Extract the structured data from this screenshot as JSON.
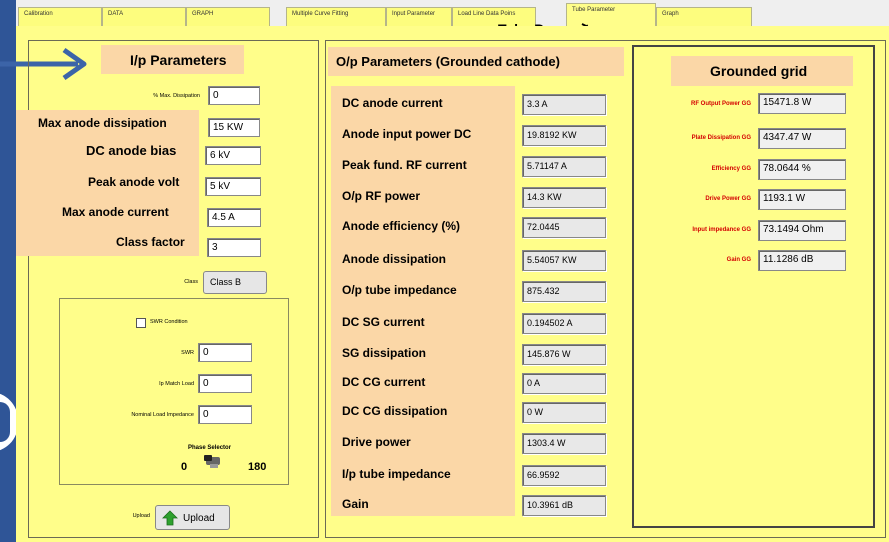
{
  "tabs": [
    "Calibration",
    "DATA",
    "GRAPH",
    "Multiple Curve Fitting",
    "Input Parameter",
    "Load Line Data Poins",
    "Tube Parameter",
    "Graph"
  ],
  "active_tab": "Tube Parameter",
  "annotation_label": "Tube Parameters",
  "input_panel": {
    "title": "I/p Parameters",
    "rows": [
      {
        "label": "% Max. Dissipation",
        "value": "0"
      },
      {
        "label": "Max anode dissipation",
        "value": "15 KW"
      },
      {
        "label": "DC anode bias",
        "value": "6 kV"
      },
      {
        "label": "Peak anode volt",
        "value": "5 kV"
      },
      {
        "label": "Max anode current",
        "value": "4.5 A"
      },
      {
        "label": "Class factor",
        "value": "3"
      },
      {
        "label": "Class",
        "value": "Class B"
      }
    ],
    "swr_checkbox_label": "SWR Condition",
    "swr_rows": [
      {
        "label": "SWR",
        "value": "0"
      },
      {
        "label": "Ip Match Load",
        "value": "0"
      },
      {
        "label": "Nominal Load Impedance",
        "value": "0"
      }
    ],
    "phase_selector": {
      "label": "Phase Selector",
      "min": "0",
      "max": "180"
    },
    "upload_label": "Upload",
    "upload_button": "Upload"
  },
  "output_panel": {
    "title": "O/p Parameters (Grounded cathode)",
    "rows": [
      {
        "label": "DC anode current",
        "value": "3.3 A"
      },
      {
        "label": "Anode input power DC",
        "value": "19.8192 KW"
      },
      {
        "label": "Peak fund. RF current",
        "value": "5.71147 A"
      },
      {
        "label": "O/p RF power",
        "value": "14.3 KW"
      },
      {
        "label": "Anode efficiency (%)",
        "value": "72.0445"
      },
      {
        "label": "Anode dissipation",
        "value": "5.54057 KW"
      },
      {
        "label": "O/p tube impedance",
        "value": "875.432"
      },
      {
        "label": "DC SG current",
        "value": "0.194502 A"
      },
      {
        "label": "SG dissipation",
        "value": "145.876 W"
      },
      {
        "label": "DC CG current",
        "value": "0 A"
      },
      {
        "label": "DC CG dissipation",
        "value": "0 W"
      },
      {
        "label": "Drive power",
        "value": "1303.4 W"
      },
      {
        "label": "I/p tube impedance",
        "value": "66.9592"
      },
      {
        "label": "Gain",
        "value": "10.3961 dB"
      }
    ]
  },
  "grid_panel": {
    "title": "Grounded grid",
    "rows": [
      {
        "label": "RF Output Power GG",
        "value": "15471.8 W"
      },
      {
        "label": "Plate Dissipation GG",
        "value": "4347.47 W"
      },
      {
        "label": "Efficiency GG",
        "value": "78.0644 %"
      },
      {
        "label": "Drive Power GG",
        "value": "1193.1 W"
      },
      {
        "label": "Input impedance GG",
        "value": "73.1494 Ohm"
      },
      {
        "label": "Gain GG",
        "value": "11.1286 dB"
      }
    ]
  },
  "colors": {
    "window": "#fffe8a",
    "peach": "#fbd7a7",
    "accent_blue": "#2f5597",
    "red_label": "#d40000"
  }
}
